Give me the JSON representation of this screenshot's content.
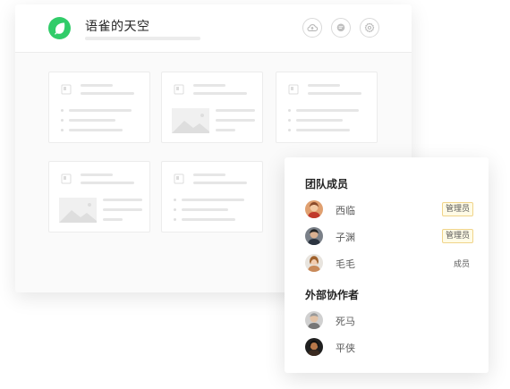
{
  "header": {
    "space_title": "语雀的天空",
    "icons": [
      "cloud-upload-icon",
      "chat-bubble-icon",
      "gear-icon"
    ]
  },
  "documents": {
    "count": 5,
    "icon": "document-icon",
    "thumbnail_icon": "image-placeholder-icon"
  },
  "members_panel": {
    "team_title": "团队成员",
    "team_members": [
      {
        "name": "西临",
        "role": "管理员"
      },
      {
        "name": "子渊",
        "role": "管理员"
      },
      {
        "name": "毛毛",
        "role": "成员"
      }
    ],
    "collaborators_title": "外部协作者",
    "collaborators": [
      {
        "name": "死马"
      },
      {
        "name": "平侠"
      }
    ]
  },
  "colors": {
    "brand": "#31cc69",
    "admin_badge_bg": "#fffbe6",
    "admin_badge_border": "#f0d48a"
  }
}
